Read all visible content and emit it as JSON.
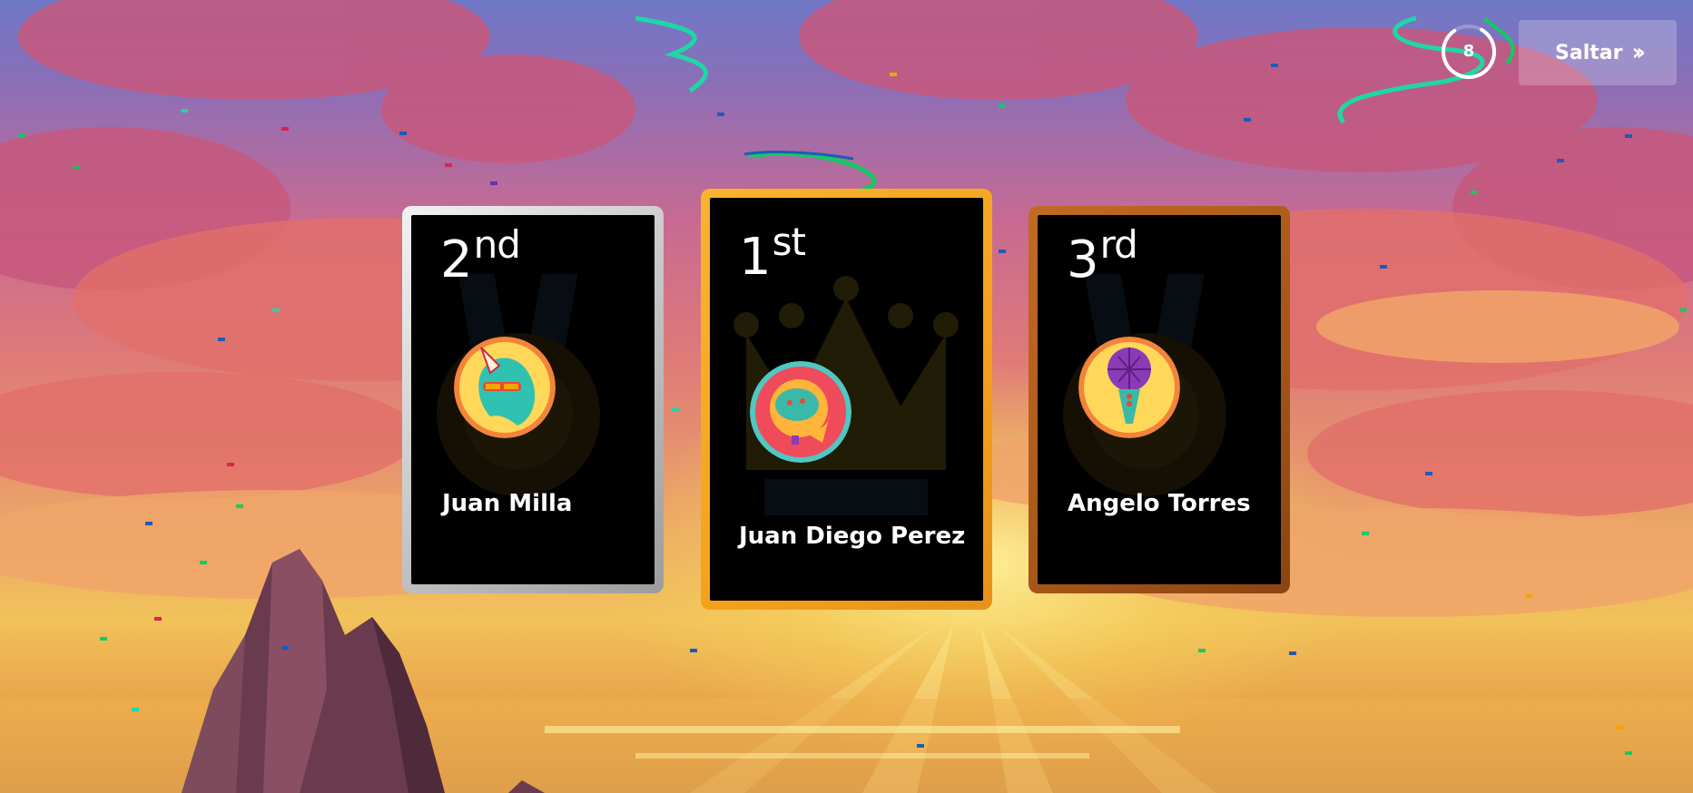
{
  "podium": {
    "second": {
      "rank_number": "2",
      "rank_suffix": "nd",
      "name": "Juan Milla",
      "avatar": "unicorn-icon",
      "frame_color": "#c9c9c9"
    },
    "first": {
      "rank_number": "1",
      "rank_suffix": "st",
      "name": "Juan Diego Perez",
      "avatar": "astronaut-icon",
      "frame_color": "#f4a21c"
    },
    "third": {
      "rank_number": "3",
      "rank_suffix": "rd",
      "name": "Angelo Torres",
      "avatar": "microphone-icon",
      "frame_color": "#a55618"
    }
  },
  "timer": {
    "value": "8",
    "progress": 0.82
  },
  "skip_button": {
    "label": "Saltar",
    "icon": "double-chevron-right-icon"
  },
  "colors": {
    "accent_green": "#1fd7a6",
    "card_background": "#000000"
  }
}
